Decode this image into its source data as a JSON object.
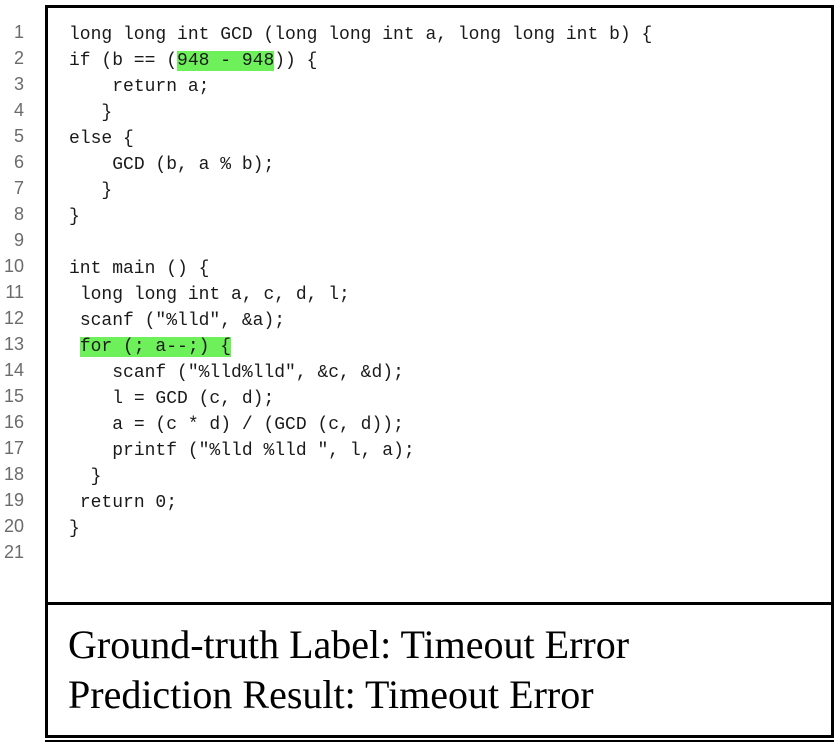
{
  "line_numbers": [
    "1",
    "2",
    "3",
    "4",
    "5",
    "6",
    "7",
    "8",
    "9",
    "10",
    "11",
    "12",
    "13",
    "14",
    "15",
    "16",
    "17",
    "18",
    "19",
    "20",
    "21"
  ],
  "code_lines": [
    {
      "indent": "",
      "pre": "long long int GCD (long long int a, long long int b) {",
      "hl": "",
      "post": ""
    },
    {
      "indent": "",
      "pre": "if (b == (",
      "hl": "948 - 948",
      "post": ")) {"
    },
    {
      "indent": "    ",
      "pre": "return a;",
      "hl": "",
      "post": ""
    },
    {
      "indent": "   ",
      "pre": "}",
      "hl": "",
      "post": ""
    },
    {
      "indent": "",
      "pre": "else {",
      "hl": "",
      "post": ""
    },
    {
      "indent": "    ",
      "pre": "GCD (b, a % b);",
      "hl": "",
      "post": ""
    },
    {
      "indent": "   ",
      "pre": "}",
      "hl": "",
      "post": ""
    },
    {
      "indent": "",
      "pre": "}",
      "hl": "",
      "post": ""
    },
    {
      "indent": "",
      "pre": "",
      "hl": "",
      "post": ""
    },
    {
      "indent": "",
      "pre": "int main () {",
      "hl": "",
      "post": ""
    },
    {
      "indent": " ",
      "pre": "long long int a, c, d, l;",
      "hl": "",
      "post": ""
    },
    {
      "indent": " ",
      "pre": "scanf (\"%lld\", &a);",
      "hl": "",
      "post": ""
    },
    {
      "indent": " ",
      "pre": "",
      "hl": "for (; a--;) {",
      "post": ""
    },
    {
      "indent": "    ",
      "pre": "scanf (\"%lld%lld\", &c, &d);",
      "hl": "",
      "post": ""
    },
    {
      "indent": "    ",
      "pre": "l = GCD (c, d);",
      "hl": "",
      "post": ""
    },
    {
      "indent": "    ",
      "pre": "a = (c * d) / (GCD (c, d));",
      "hl": "",
      "post": ""
    },
    {
      "indent": "    ",
      "pre": "printf (\"%lld %lld \", l, a);",
      "hl": "",
      "post": ""
    },
    {
      "indent": "  ",
      "pre": "}",
      "hl": "",
      "post": ""
    },
    {
      "indent": " ",
      "pre": "return 0;",
      "hl": "",
      "post": ""
    },
    {
      "indent": "",
      "pre": "}",
      "hl": "",
      "post": ""
    },
    {
      "indent": "",
      "pre": "",
      "hl": "",
      "post": ""
    }
  ],
  "result": {
    "ground_truth": "Ground-truth Label: Timeout Error",
    "prediction": "Prediction Result: Timeout Error"
  },
  "colors": {
    "highlight": "#6ef05a",
    "frame": "#000000",
    "line_number": "#6b6b6b"
  }
}
